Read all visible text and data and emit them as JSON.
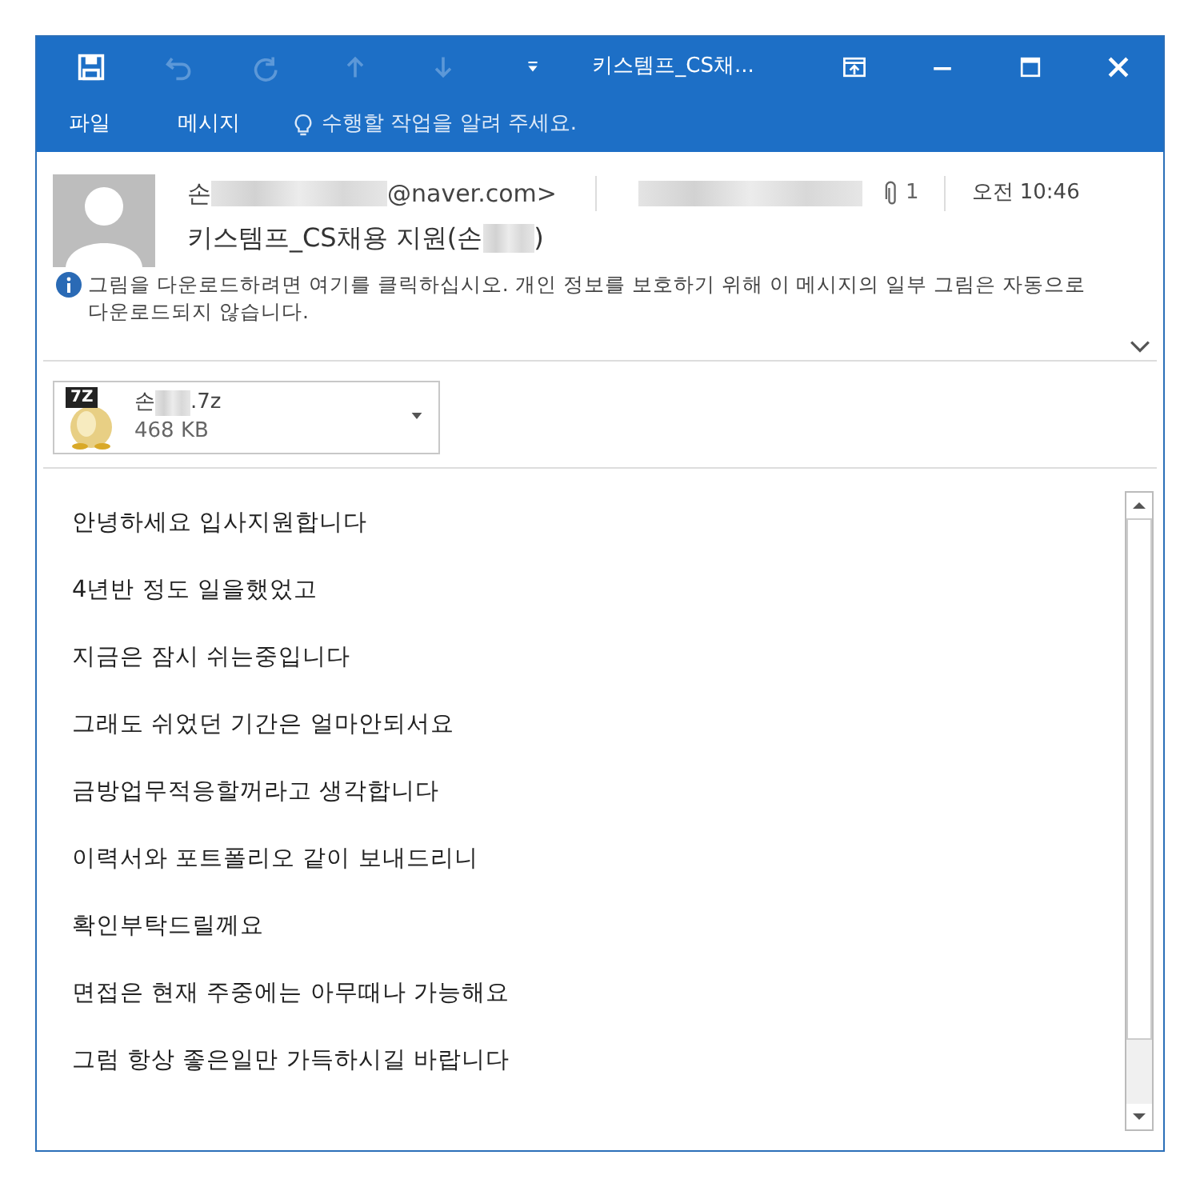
{
  "window": {
    "title": "키스템프_CS채...",
    "toolbar": [
      {
        "kind": "save",
        "disabled": false
      },
      {
        "kind": "undo",
        "disabled": true
      },
      {
        "kind": "redo",
        "disabled": true
      },
      {
        "kind": "up",
        "disabled": true
      },
      {
        "kind": "down",
        "disabled": true
      },
      {
        "kind": "customize",
        "disabled": false
      }
    ],
    "controls": [
      {
        "kind": "ribbon"
      },
      {
        "kind": "minimize"
      },
      {
        "kind": "maximize"
      },
      {
        "kind": "close"
      }
    ]
  },
  "ribbon_tabs": [
    {
      "label": "파일"
    },
    {
      "label": "메시지"
    }
  ],
  "tell_me": {
    "placeholder": "수행할 작업을 알려 주세요."
  },
  "message": {
    "from_prefix": "손",
    "from_suffix": "@naver.com>",
    "attachment_count": "1",
    "time": "오전 10:46",
    "subject_prefix": "키스템프_CS채용 지원(손",
    "subject_suffix": ")",
    "info": "그림을 다운로드하려면 여기를 클릭하십시오. 개인 정보를 보호하기 위해 이 메시지의 일부 그림은 자동으로 다운로드되지 않습니다."
  },
  "attachment": {
    "type_label": "7Z",
    "name_prefix": "손",
    "name_suffix": ".7z",
    "size": "468 KB"
  },
  "body": [
    "안녕하세요 입사지원합니다",
    "4년반 정도 일을했었고",
    "지금은 잠시 쉬는중입니다",
    "그래도 쉬었던 기간은 얼마안되서요",
    "금방업무적응할꺼라고 생각합니다",
    "이력서와 포트폴리오 같이 보내드리니",
    "확인부탁드릴께요",
    "면접은 현재 주중에는 아무때나 가능해요",
    "그럼 항상 좋은일만 가득하시길 바랍니다"
  ]
}
